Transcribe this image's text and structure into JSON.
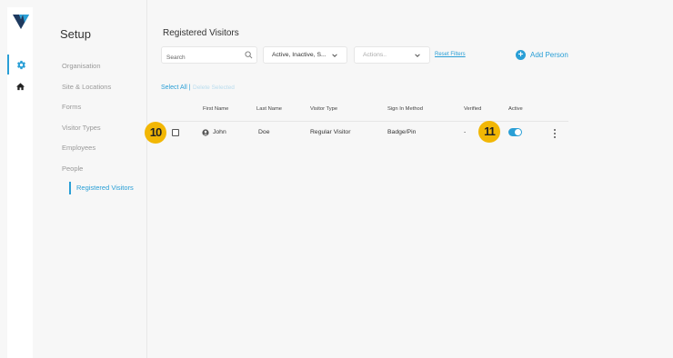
{
  "setup_title": "Setup",
  "menu": [
    {
      "label": "Organisation"
    },
    {
      "label": "Site & Locations"
    },
    {
      "label": "Forms"
    },
    {
      "label": "Visitor Types"
    },
    {
      "label": "Employees"
    },
    {
      "label": "People"
    }
  ],
  "menu_sub": {
    "label": "Registered Visitors"
  },
  "page_title": "Registered Visitors",
  "search": {
    "placeholder": "Search"
  },
  "status_filter": {
    "value": "Active, Inactive, S..."
  },
  "actions_dropdown": {
    "placeholder": "Actions.."
  },
  "reset_filters": "Reset Filters",
  "add_person": "Add Person",
  "select_all": "Select All |",
  "delete_selected": "Delete Selected",
  "table": {
    "headers": [
      "First Name",
      "Last Name",
      "Visitor Type",
      "Sign In Method",
      "Verified",
      "Active"
    ],
    "rows": [
      {
        "first_name": "John",
        "last_name": "Doe",
        "visitor_type": "Regular Visitor",
        "sign_in_method": "Badge/Pin",
        "verified": "-",
        "active": true
      }
    ]
  },
  "callouts": [
    "10",
    "11"
  ],
  "colors": {
    "accent": "#2a9fd6",
    "callout": "#f2b705"
  },
  "icons": [
    "logo-icon",
    "gear-icon",
    "home-icon",
    "search-icon",
    "chevron-down-icon",
    "plus-icon",
    "user-avatar-icon",
    "kebab-menu-icon"
  ]
}
